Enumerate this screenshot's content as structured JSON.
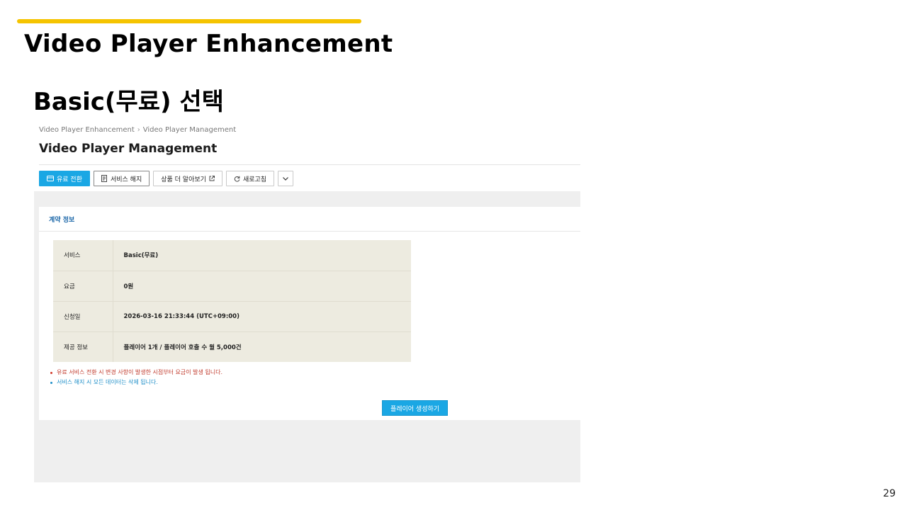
{
  "slide": {
    "title": "Video Player Enhancement",
    "subtitle": "Basic(무료) 선택",
    "page_number": "29",
    "accent_color": "#f5c400"
  },
  "breadcrumb": {
    "items": [
      "Video Player Enhancement",
      "Video Player Management"
    ]
  },
  "page": {
    "heading": "Video Player Management"
  },
  "toolbar": {
    "switch_paid_label": "유료 전환",
    "cancel_service_label": "서비스 해지",
    "learn_more_label": "상품 더 알아보기",
    "refresh_label": "새로고침",
    "more_icon": "chevron-down-icon",
    "primary_color": "#1aa7e4"
  },
  "contract": {
    "title": "계약 정보",
    "rows": [
      {
        "key": "서비스",
        "value": "Basic(무료)"
      },
      {
        "key": "요금",
        "value": "0원"
      },
      {
        "key": "신청일",
        "value": "2026-03-16 21:33:44 (UTC+09:00)"
      },
      {
        "key": "제공 정보",
        "value": "플레이어 1개 / 플레이어 호출 수 월 5,000건"
      }
    ],
    "notes": [
      {
        "text": "유료 서비스 전환 시 변경 사항이 발생한 시점부터 요금이 발생 됩니다.",
        "color": "#c0392b"
      },
      {
        "text": "서비스 해지 시 모든 데이터는 삭제 됩니다.",
        "color": "#1f8fc8"
      }
    ],
    "create_button_label": "플레이어 생성하기"
  }
}
